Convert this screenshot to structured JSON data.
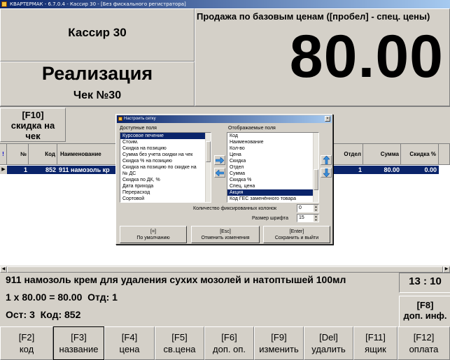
{
  "window": {
    "title": "КВАРТЕРМАК - 6.7.0.4 - Кассир 30 - [Без фискального регистратора]"
  },
  "header": {
    "cashier": "Кассир 30",
    "mode": "Реализация",
    "check": "Чек №30",
    "price_mode": "Продажа по базовым ценам ([пробел] - спец. цены)",
    "total": "80.00"
  },
  "discount_button": {
    "key": "[F10]",
    "line1": "скидка на",
    "line2": "чек"
  },
  "grid": {
    "marker": "!",
    "columns": [
      "№",
      "Код",
      "Наименование",
      "Отдел",
      "Сумма",
      "Скидка %"
    ],
    "row": {
      "num": "1",
      "code": "852",
      "name": "911 намозоль кр",
      "dept": "1",
      "sum": "80.00",
      "discount": "0.00"
    }
  },
  "dialog": {
    "title": "Настроить сетку",
    "available_label": "Доступные поля",
    "available": [
      "Курсовое печение",
      "Стоим.",
      "Скидка на позицию",
      "Сумма без учета скидки на чек",
      "Скидка % на позицию",
      "Скидка на позицию по скидке на",
      "№ ДС",
      "Скидка по ДК, %",
      "Дата прихода",
      "Перерасход",
      "Сортовой"
    ],
    "displayed_label": "Отображаемые поля",
    "displayed": [
      "Код",
      "  Наименование",
      "Кол-во",
      "Цена",
      "Скидка",
      "Отдел",
      "Сумма",
      "Скидка %",
      "Спец. цена",
      "Акция",
      "Код ГЕС заменённого товара"
    ],
    "fixed_cols_label": "Количество фиксированных колонок",
    "fixed_cols_value": "0",
    "font_size_label": "Размер шрифта",
    "font_size_value": "15",
    "buttons": [
      {
        "key": "[=]",
        "label": "По умолчанию"
      },
      {
        "key": "[Esc]",
        "label": "Отменить изменения"
      },
      {
        "key": "[Enter]",
        "label": "Сохранить и выйти"
      }
    ]
  },
  "item_info": {
    "name": "911 намозоль крем для удаления сухих мозолей и натоптышей 100мл",
    "calc": "1 x 80.00 = 80.00",
    "dept": "Отд: 1",
    "stock": "Ост: 3",
    "code": "Код: 852"
  },
  "clock": "13 : 10",
  "more_button": {
    "key": "[F8]",
    "label": "доп. инф."
  },
  "fkeys": [
    {
      "key": "[F2]",
      "label": "код"
    },
    {
      "key": "[F3]",
      "label": "название"
    },
    {
      "key": "[F4]",
      "label": "цена"
    },
    {
      "key": "[F5]",
      "label": "св.цена"
    },
    {
      "key": "[F6]",
      "label": "доп. оп."
    },
    {
      "key": "[F9]",
      "label": "изменить"
    },
    {
      "key": "[Del]",
      "label": "удалить"
    },
    {
      "key": "[F11]",
      "label": "ящик"
    },
    {
      "key": "[F12]",
      "label": "оплата"
    }
  ],
  "colors": {
    "selection": "#0a246a",
    "panel": "#d4d0c8",
    "highlight_row": "#0a246a"
  }
}
